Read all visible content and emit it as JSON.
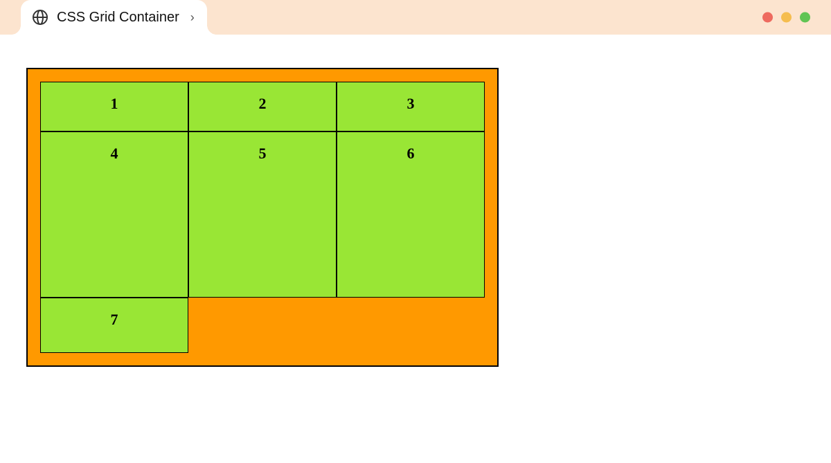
{
  "tab": {
    "title": "CSS Grid Container"
  },
  "grid": {
    "cells": {
      "c1": "1",
      "c2": "2",
      "c3": "3",
      "c4": "4",
      "c5": "5",
      "c6": "6",
      "c7": "7"
    }
  }
}
